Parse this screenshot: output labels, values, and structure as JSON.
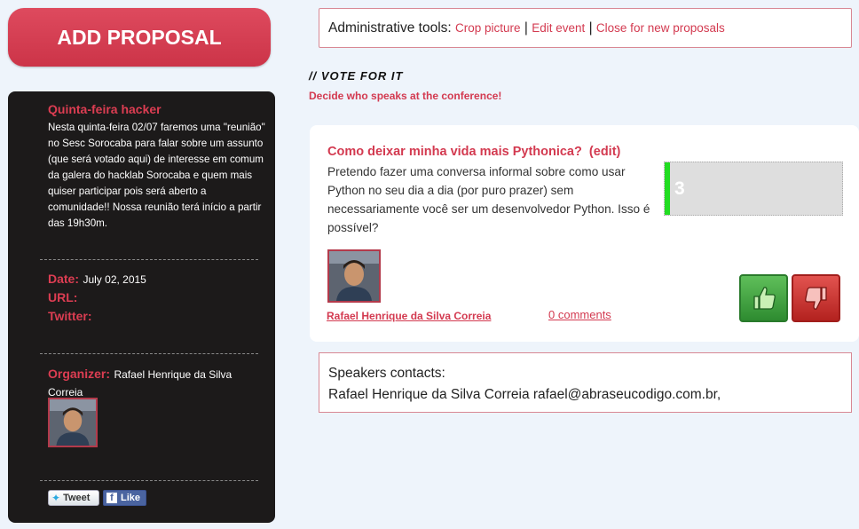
{
  "sidebar": {
    "add_button": "ADD PROPOSAL",
    "event": {
      "title": "Quinta-feira hacker",
      "description": "Nesta quinta-feira 02/07 faremos uma \"reunião\" no Sesc Sorocaba para falar sobre um assunto (que será votado aqui) de interesse em comum da galera do hacklab Sorocaba e quem mais quiser participar pois será aberto a comunidade!! Nossa reunião terá início a partir das 19h30m.",
      "date_label": "Date:",
      "date_value": "July 02, 2015",
      "url_label": "URL:",
      "twitter_label": "Twitter:",
      "organizer_label": "Organizer:",
      "organizer_name": "Rafael Henrique da Silva Correia"
    },
    "social": {
      "tweet": "Tweet",
      "like": "Like"
    }
  },
  "admin": {
    "label": "Administrative tools:",
    "links": [
      "Crop picture",
      "Edit event",
      "Close for new proposals"
    ],
    "separator": "|"
  },
  "vote": {
    "heading": "// VOTE FOR IT",
    "subheading": "Decide who speaks at the conference!"
  },
  "proposal": {
    "title": "Como deixar minha vida mais Pythonica?",
    "edit": "(edit)",
    "description": "Pretendo fazer uma conversa informal sobre como usar Python no seu dia a dia (por puro prazer) sem necessariamente você ser um desenvolvedor Python. Isso é possível?",
    "votes": "3",
    "author": "Rafael Henrique da Silva Correia",
    "comments": "0 comments"
  },
  "speakers": {
    "label": "Speakers contacts:",
    "contact": "Rafael Henrique da Silva Correia rafael@abraseucodigo.com.br,"
  },
  "colors": {
    "accent": "#d33a50",
    "sidebar_bg": "#1c1a1a",
    "vote_bar": "#22dd22",
    "page_bg": "#eef4fb"
  }
}
